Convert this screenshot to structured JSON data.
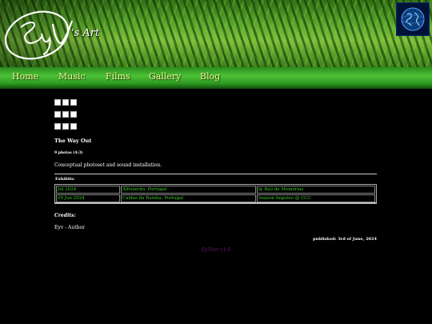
{
  "header": {
    "logo_text": "'s Art",
    "logo_signature": "EyV",
    "earth_icon": "earth-globe-icon"
  },
  "nav": {
    "items": [
      {
        "label": "Home"
      },
      {
        "label": "Music"
      },
      {
        "label": "Films"
      },
      {
        "label": "Gallery"
      },
      {
        "label": "Blog"
      }
    ]
  },
  "gallery": {
    "thumbnail_rows": 3,
    "thumbnails_per_row": 3
  },
  "project": {
    "title": "The Way Out",
    "photos": "9 photos (4:3)",
    "description": "Conceptual photoset and sound installation."
  },
  "exhibits": {
    "label": "Exhibits:",
    "rows": [
      {
        "date": "Jul 2024",
        "place": "Alfeizerão, Portugal",
        "venue": "@ Baú de Memórias"
      },
      {
        "date": "09 Jun 2024",
        "place": "Caldas da Rainha, Portugal",
        "venue": "Season Impulso @ CCC"
      }
    ]
  },
  "credits": {
    "label": "Credits:",
    "line": "Eyv - Author"
  },
  "published": "published: 3rd of June, 2024",
  "footer": "EyVArt v1.0",
  "colors": {
    "link_green": "#3ecf28",
    "nav_text": "#f4f09a",
    "footer_text": "#6a1a6a",
    "background": "#000000"
  }
}
